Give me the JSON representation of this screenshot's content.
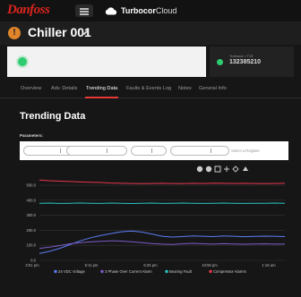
{
  "topbar": {
    "logo": "Danfoss",
    "brand_bold": "Turbocor",
    "brand_light": "Cloud"
  },
  "header": {
    "title": "Chiller 001"
  },
  "status": {
    "serial_label": "Turbocor • T15",
    "serial_value": "132385210"
  },
  "tabs": [
    "Overview",
    "Adv. Details",
    "Trending Data",
    "Faults & Events Log",
    "Notes",
    "General Info"
  ],
  "active_tab": "Trending Data",
  "section": {
    "title": "Trending Data",
    "params_label": "Parameters:",
    "select_hint": "Select a Register"
  },
  "colors": {
    "accent": "#e53935",
    "ok": "#2ecc71",
    "warn": "#e0852a"
  },
  "chart_data": {
    "type": "line",
    "y_ticks": [
      "0.0",
      "100.0",
      "200.0",
      "300.0",
      "400.0",
      "500.0"
    ],
    "ylim": [
      0,
      560
    ],
    "x_ticks": [
      "2:51 pm",
      "5:11 pm",
      "6:25 pm",
      "10:59 pm",
      "1:16 am"
    ],
    "grid": true,
    "legend_position": "bottom",
    "series": [
      {
        "name": "24 VDC Voltage",
        "color": "#5b7cf5",
        "values": [
          45,
          60,
          80,
          105,
          130,
          150,
          165,
          178,
          190,
          195,
          188,
          175,
          160,
          155,
          158,
          162,
          160,
          158,
          162,
          160,
          157,
          159,
          161,
          160,
          158
        ]
      },
      {
        "name": "3 Phase Over Current Alarm",
        "color": "#7b5cc8",
        "values": [
          80,
          88,
          98,
          110,
          118,
          123,
          126,
          130,
          128,
          124,
          118,
          112,
          108,
          106,
          110,
          113,
          110,
          108,
          111,
          109,
          107,
          109,
          110,
          108,
          109
        ]
      },
      {
        "name": "Bearing Fault",
        "color": "#2bc4c4",
        "values": [
          380,
          381,
          379,
          380,
          382,
          380,
          379,
          381,
          380,
          378,
          380,
          381,
          379,
          380,
          381,
          380,
          379,
          380,
          381,
          380,
          379,
          380,
          380,
          381,
          380
        ]
      },
      {
        "name": "Compressor Alarms",
        "color": "#e8374d",
        "values": [
          535,
          530,
          527,
          525,
          522,
          520,
          518,
          515,
          513,
          512,
          511,
          512,
          513,
          512,
          511,
          513,
          512,
          514,
          513,
          512,
          513,
          512,
          511,
          512,
          513
        ]
      }
    ]
  }
}
